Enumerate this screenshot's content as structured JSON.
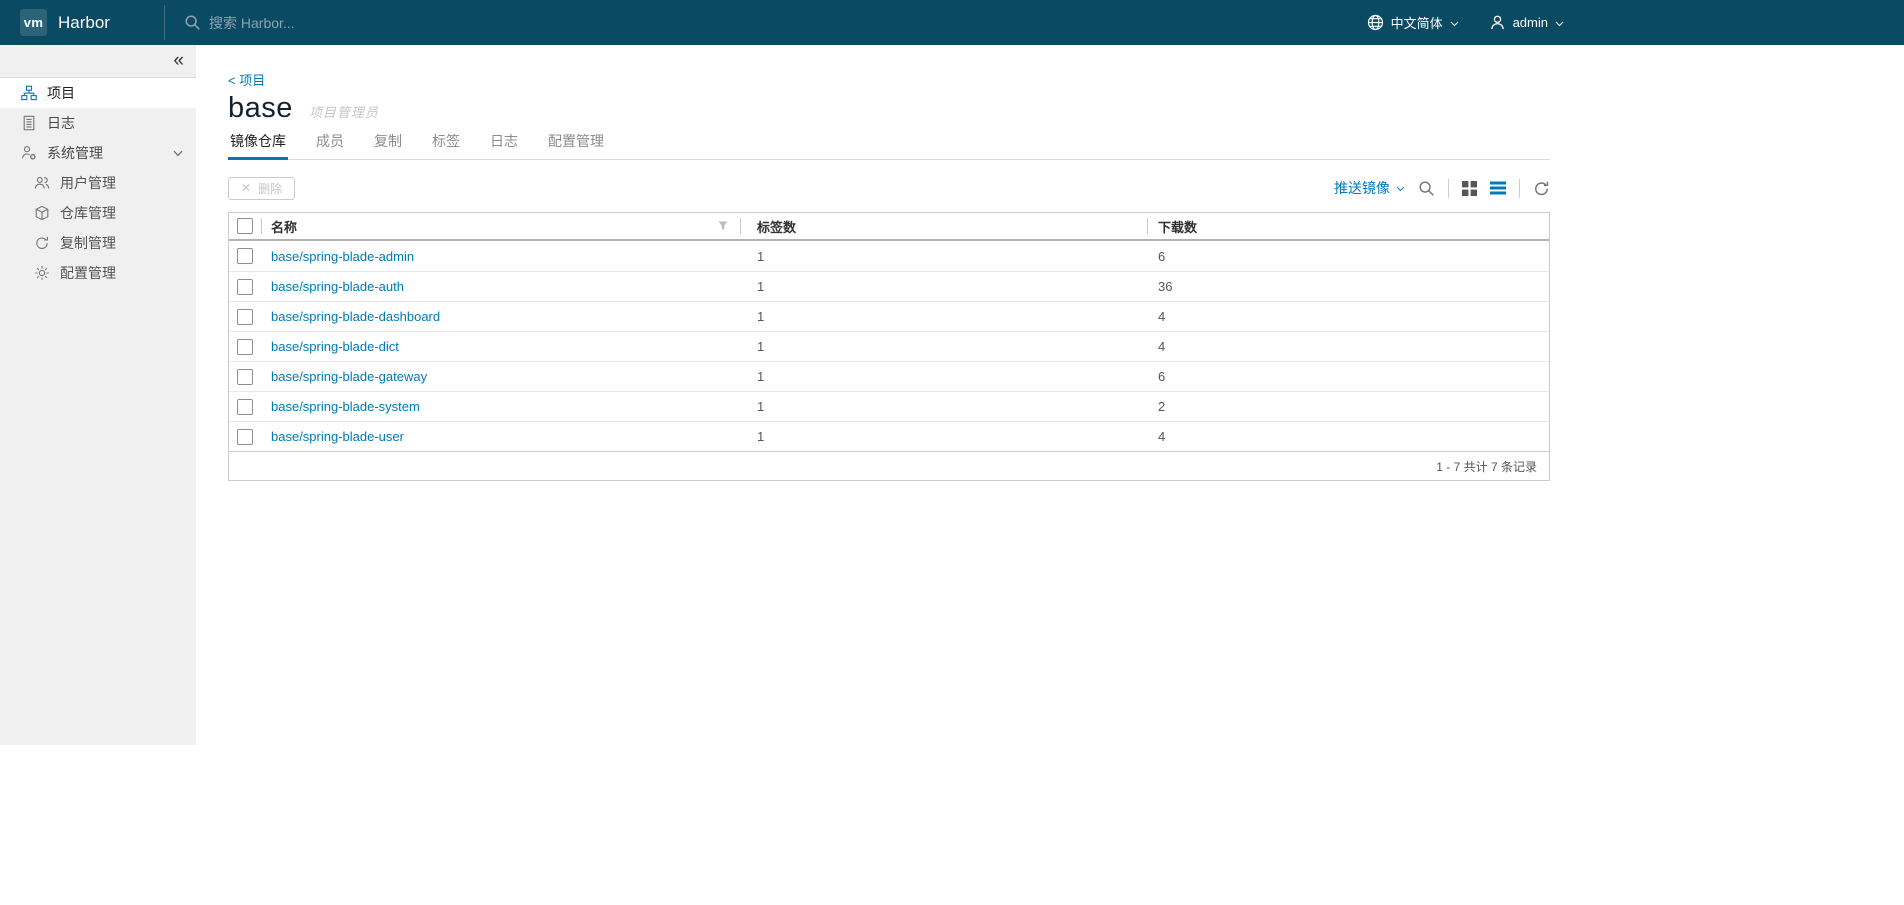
{
  "colors": {
    "header_bg": "#0b4a63",
    "sidebar_bg": "#f0f0f0",
    "accent": "#0079b8",
    "link": "#0079b8"
  },
  "navbar": {
    "logo": "vm",
    "brand": "Harbor",
    "search_placeholder": "搜索 Harbor...",
    "language": "中文简体",
    "username": "admin",
    "icons": [
      "search-icon",
      "globe-icon",
      "user-icon"
    ]
  },
  "sidebar": {
    "collapse_glyph": "«",
    "items": [
      {
        "label": "项目",
        "icon": "projects-icon",
        "active": true
      },
      {
        "label": "日志",
        "icon": "logs-icon",
        "active": false
      },
      {
        "label": "系统管理",
        "icon": "administration-icon",
        "active": false,
        "expanded": true,
        "children": [
          {
            "label": "用户管理",
            "icon": "users-icon"
          },
          {
            "label": "仓库管理",
            "icon": "registry-icon"
          },
          {
            "label": "复制管理",
            "icon": "replication-icon"
          },
          {
            "label": "配置管理",
            "icon": "config-icon"
          }
        ]
      }
    ]
  },
  "main": {
    "breadcrumb": "< 项目",
    "title": "base",
    "role_badge": "项目管理员",
    "tabs": [
      {
        "label": "镜像仓库",
        "active": true
      },
      {
        "label": "成员",
        "active": false
      },
      {
        "label": "复制",
        "active": false
      },
      {
        "label": "标签",
        "active": false
      },
      {
        "label": "日志",
        "active": false
      },
      {
        "label": "配置管理",
        "active": false
      }
    ],
    "toolbar": {
      "delete_label": "删除",
      "push_image_label": "推送镜像",
      "icons": [
        "search-icon",
        "card-view-icon",
        "list-view-icon",
        "refresh-icon"
      ],
      "active_view": "list"
    },
    "table": {
      "columns": [
        "名称",
        "标签数",
        "下载数"
      ],
      "rows": [
        {
          "name": "base/spring-blade-admin",
          "tags": "1",
          "pulls": "6"
        },
        {
          "name": "base/spring-blade-auth",
          "tags": "1",
          "pulls": "36"
        },
        {
          "name": "base/spring-blade-dashboard",
          "tags": "1",
          "pulls": "4"
        },
        {
          "name": "base/spring-blade-dict",
          "tags": "1",
          "pulls": "4"
        },
        {
          "name": "base/spring-blade-gateway",
          "tags": "1",
          "pulls": "6"
        },
        {
          "name": "base/spring-blade-system",
          "tags": "1",
          "pulls": "2"
        },
        {
          "name": "base/spring-blade-user",
          "tags": "1",
          "pulls": "4"
        }
      ],
      "footer": "1 - 7 共计 7 条记录"
    }
  }
}
